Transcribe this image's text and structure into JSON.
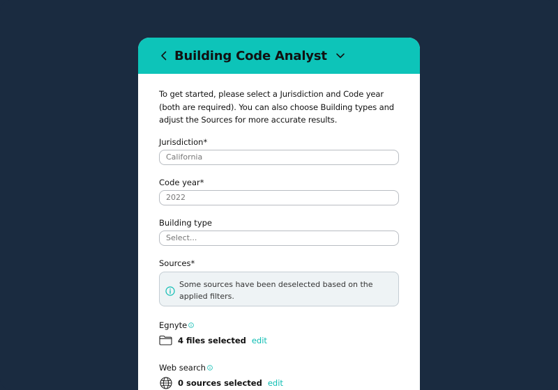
{
  "colors": {
    "background": "#1a2b40",
    "accent": "#0dc4b9",
    "link": "#0dbdb3"
  },
  "header": {
    "title": "Building Code Analyst",
    "back_icon": "chevron-left-icon",
    "menu_icon": "chevron-down-icon"
  },
  "intro": "To get started, please select a Jurisdiction and Code year (both are required). You can also choose Building types and adjust the Sources for more accurate results.",
  "fields": {
    "jurisdiction": {
      "label": "Jurisdiction*",
      "value": "California"
    },
    "code_year": {
      "label": "Code year*",
      "value": "2022"
    },
    "building_type": {
      "label": "Building type",
      "placeholder": "Select..."
    }
  },
  "sources": {
    "label": "Sources*",
    "notice": "Some sources have been deselected based on the applied filters.",
    "notice_icon": "info-circle-icon",
    "egnyte": {
      "label": "Egnyte",
      "icon": "folder-icon",
      "count": "4 files selected",
      "edit": "edit"
    },
    "web": {
      "label": "Web search",
      "icon": "globe-icon",
      "count": "0 sources selected",
      "edit": "edit"
    }
  }
}
